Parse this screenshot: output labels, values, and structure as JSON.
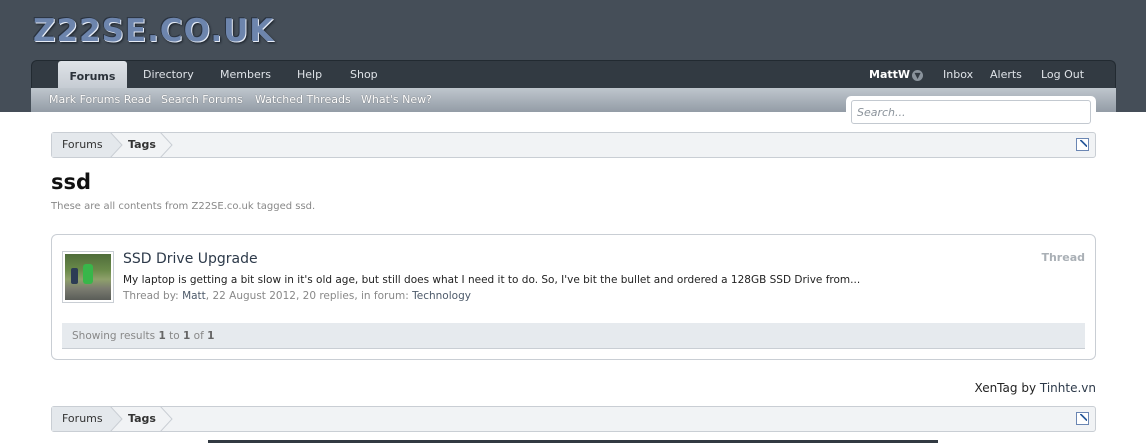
{
  "site": {
    "logo_text": "Z22SE.CO.UK"
  },
  "nav": {
    "tabs": [
      "Forums",
      "Directory",
      "Members",
      "Help",
      "Shop"
    ],
    "user": "MattW",
    "right_links": [
      "Inbox",
      "Alerts",
      "Log Out"
    ]
  },
  "subnav": {
    "links": [
      "Mark Forums Read",
      "Search Forums",
      "Watched Threads",
      "What's New?"
    ]
  },
  "search": {
    "placeholder": "Search..."
  },
  "breadcrumb": {
    "items": [
      "Forums",
      "Tags"
    ]
  },
  "page": {
    "title": "ssd",
    "description": "These are all contents from Z22SE.co.uk tagged ssd."
  },
  "results": [
    {
      "title": "SSD Drive Upgrade",
      "type": "Thread",
      "snippet": "My laptop is getting a bit slow in it's old age, but still does what I need it to do. So, I've bit the bullet and ordered a 128GB SSD Drive from...",
      "meta_prefix": "Thread by:",
      "author": "Matt",
      "meta_middle": ", 22 August 2012, 20 replies, in forum:",
      "forum": "Technology"
    }
  ],
  "showing": {
    "prefix": "Showing results",
    "from": "1",
    "to_word": "to",
    "to": "1",
    "of_word": "of",
    "total": "1"
  },
  "footer": {
    "xentag": "XenTag",
    "by": "by",
    "tinhte": "Tinhte.vn"
  },
  "colors": {
    "header": "#454e58",
    "nav": "#323a42",
    "accent": "#6d85ad"
  }
}
